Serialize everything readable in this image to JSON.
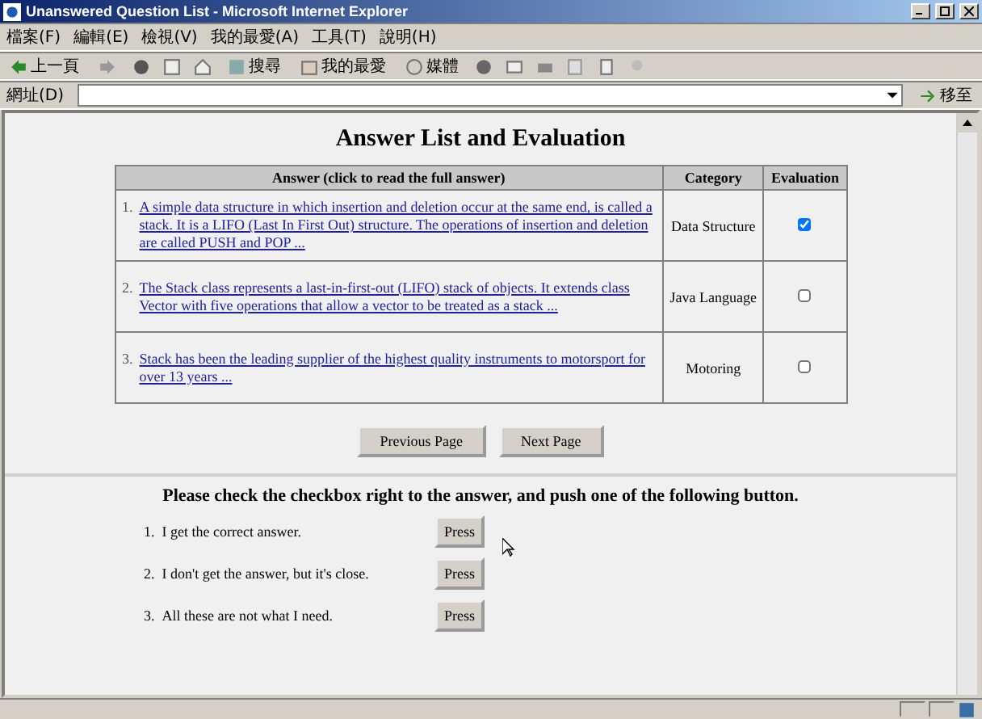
{
  "window": {
    "title": "Unanswered Question List - Microsoft Internet Explorer"
  },
  "menu": [
    "檔案(F)",
    "編輯(E)",
    "檢視(V)",
    "我的最愛(A)",
    "工具(T)",
    "說明(H)"
  ],
  "toolbar": {
    "back": "上一頁",
    "search": "搜尋",
    "favorites": "我的最愛",
    "media": "媒體"
  },
  "address": {
    "label": "網址(D)",
    "go": "移至"
  },
  "page": {
    "heading": "Answer List and Evaluation",
    "columns": [
      "Answer (click to read the full answer)",
      "Category",
      "Evaluation"
    ],
    "rows": [
      {
        "number": "1.",
        "answer": "A simple data structure in which insertion and deletion occur at the same end, is called a stack. It is a LIFO (Last In First Out) structure. The operations of insertion and deletion are called PUSH and POP ...",
        "category": "Data Structure",
        "checked": true
      },
      {
        "number": "2.",
        "answer": "The Stack class represents a last-in-first-out (LIFO) stack of objects. It extends class Vector with five operations that allow a vector to be treated as a stack ...",
        "category": "Java Language",
        "checked": false
      },
      {
        "number": "3.",
        "answer": "Stack has been the leading supplier of the highest quality instruments to motorsport for over 13 years ...",
        "category": "Motoring",
        "checked": false
      }
    ],
    "nav": [
      "Previous Page",
      "Next Page"
    ],
    "instruction": "Please check the checkbox right to the answer, and push one of the following button.",
    "options": [
      {
        "number": "1.",
        "text": "I get the correct answer.",
        "button": "Press"
      },
      {
        "number": "2.",
        "text": "I don't get the answer, but it's close.",
        "button": "Press"
      },
      {
        "number": "3.",
        "text": "All these are not what I need.",
        "button": "Press"
      }
    ]
  }
}
